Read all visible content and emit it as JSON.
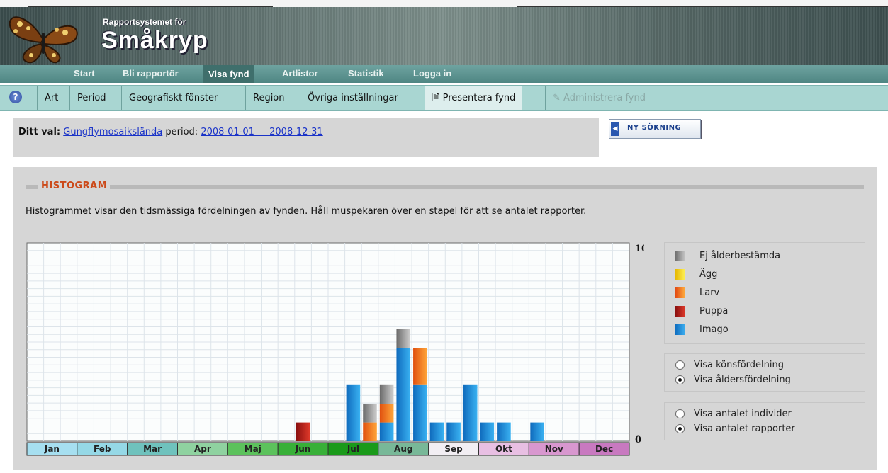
{
  "header": {
    "subtitle": "Rapportsystemet för",
    "title": "Småkryp"
  },
  "main_nav": [
    {
      "label": "Start",
      "active": false
    },
    {
      "label": "Bli rapportör",
      "active": false
    },
    {
      "label": "Visa fynd",
      "active": true
    },
    {
      "label": "Artlistor",
      "active": false
    },
    {
      "label": "Statistik",
      "active": false
    },
    {
      "label": "Logga in",
      "active": false
    }
  ],
  "sub_nav": {
    "help_icon": "question-icon",
    "tabs": [
      {
        "label": "Art"
      },
      {
        "label": "Period"
      },
      {
        "label": "Geografiskt fönster"
      },
      {
        "label": "Region"
      },
      {
        "label": "Övriga inställningar"
      },
      {
        "label": "Presentera fynd",
        "icon": "document-icon"
      },
      {
        "label": "Administrera fynd",
        "icon": "edit-icon",
        "disabled": true
      }
    ]
  },
  "selection": {
    "prefix": "Ditt val:",
    "species_link": "Gungflymosaiksländа",
    "period_label": "period:",
    "period_link": "2008-01-01 — 2008-12-31"
  },
  "new_search_button": "NY SÖKNING",
  "histogram": {
    "title": "HISTOGRAM",
    "description": "Histogrammet visar den tidsmässiga fördelningen av fynden. Håll muspekaren över en stapel för att se antalet rapporter."
  },
  "legend": [
    {
      "label": "Ej ålderbestämda",
      "color": "#8c8c8c"
    },
    {
      "label": "Ägg",
      "color": "#f2d21c"
    },
    {
      "label": "Larv",
      "color": "#f07a1e"
    },
    {
      "label": "Puppa",
      "color": "#b01a1a"
    },
    {
      "label": "Imago",
      "color": "#1f8ad8"
    }
  ],
  "options_distribution": [
    {
      "label": "Visa könsfördelning",
      "selected": false
    },
    {
      "label": "Visa åldersfördelning",
      "selected": true
    }
  ],
  "options_count": [
    {
      "label": "Visa antalet individer",
      "selected": false
    },
    {
      "label": "Visa antalet rapporter",
      "selected": true
    }
  ],
  "chart_data": {
    "type": "bar",
    "stacked": true,
    "ylim": [
      0,
      10
    ],
    "y_ticks": [
      "10",
      "0"
    ],
    "months": [
      {
        "label": "Jan",
        "color": "#a6dff0"
      },
      {
        "label": "Feb",
        "color": "#95d8e6"
      },
      {
        "label": "Mar",
        "color": "#6fc2bd"
      },
      {
        "label": "Apr",
        "color": "#8fd2a0"
      },
      {
        "label": "Maj",
        "color": "#5cc25c"
      },
      {
        "label": "Jun",
        "color": "#38b038"
      },
      {
        "label": "Jul",
        "color": "#1a9a1a"
      },
      {
        "label": "Aug",
        "color": "#78b898"
      },
      {
        "label": "Sep",
        "color": "#f2eef3"
      },
      {
        "label": "Okt",
        "color": "#e8bfe3"
      },
      {
        "label": "Nov",
        "color": "#d897cf"
      },
      {
        "label": "Dec",
        "color": "#c879c0"
      }
    ],
    "bins_per_month": 3,
    "series": [
      "Ej ålderbestämda",
      "Ägg",
      "Larv",
      "Puppa",
      "Imago"
    ],
    "bars": [
      {
        "bin": 16,
        "values": {
          "Puppa": 1
        }
      },
      {
        "bin": 19,
        "values": {
          "Imago": 3
        }
      },
      {
        "bin": 20,
        "values": {
          "Ej ålderbestämda": 1,
          "Larv": 1
        }
      },
      {
        "bin": 21,
        "values": {
          "Ej ålderbestämda": 1,
          "Larv": 1,
          "Imago": 1
        }
      },
      {
        "bin": 22,
        "values": {
          "Ej ålderbestämda": 1,
          "Imago": 5
        }
      },
      {
        "bin": 23,
        "values": {
          "Larv": 2,
          "Imago": 3
        }
      },
      {
        "bin": 24,
        "values": {
          "Imago": 1
        }
      },
      {
        "bin": 25,
        "values": {
          "Imago": 1
        }
      },
      {
        "bin": 26,
        "values": {
          "Imago": 3
        }
      },
      {
        "bin": 27,
        "values": {
          "Imago": 1
        }
      },
      {
        "bin": 28,
        "values": {
          "Imago": 1
        }
      },
      {
        "bin": 30,
        "values": {
          "Imago": 1
        }
      }
    ]
  }
}
